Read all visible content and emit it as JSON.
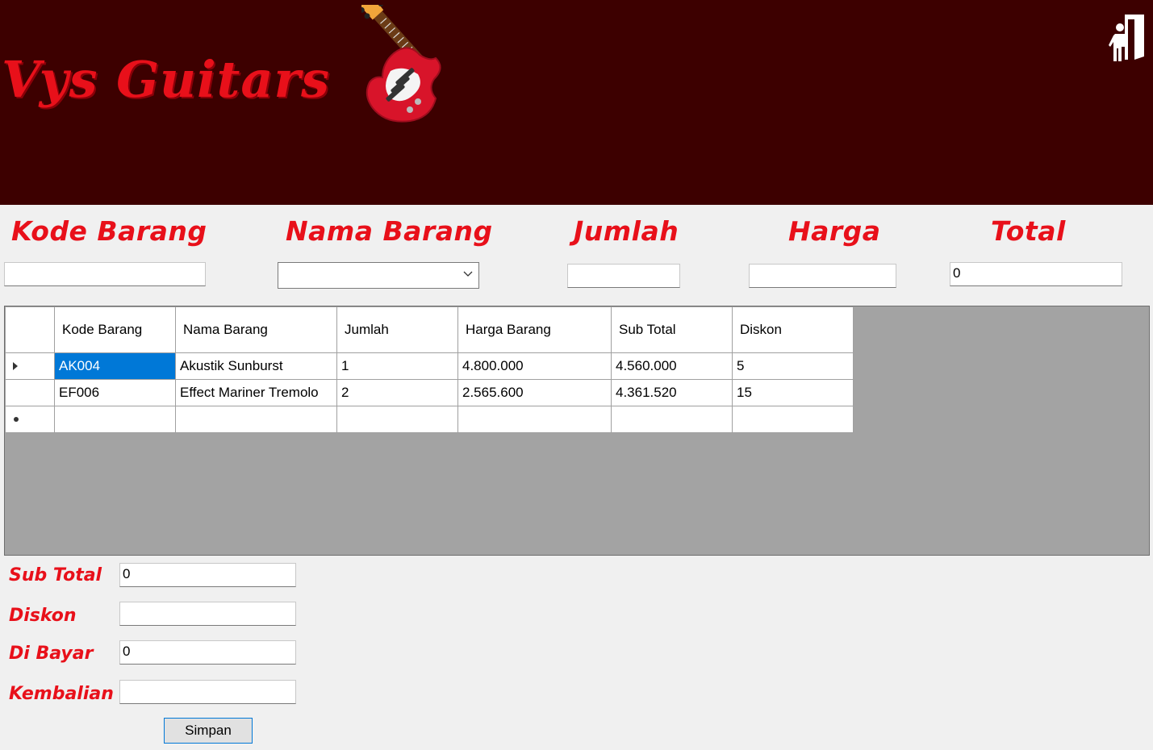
{
  "header": {
    "brand": "Vys Guitars",
    "bg_color": "#3d0000",
    "accent_color": "#e8101a",
    "logo_icon": "guitar-icon",
    "exit_icon": "exit-door-icon"
  },
  "form": {
    "kode_barang": {
      "label": "Kode Barang",
      "value": ""
    },
    "nama_barang": {
      "label": "Nama Barang",
      "value": ""
    },
    "jumlah": {
      "label": "Jumlah",
      "value": ""
    },
    "harga": {
      "label": "Harga",
      "value": ""
    },
    "total": {
      "label": "Total",
      "value": "0"
    }
  },
  "grid": {
    "columns": [
      "Kode Barang",
      "Nama Barang",
      "Jumlah",
      "Harga Barang",
      "Sub Total",
      "Diskon"
    ],
    "rows": [
      [
        "AK004",
        "Akustik Sunburst",
        "1",
        "4.800.000",
        "4.560.000",
        "5"
      ],
      [
        "EF006",
        "Effect Mariner Tremolo",
        "2",
        "2.565.600",
        "4.361.520",
        "15"
      ]
    ],
    "selection_color": "#0078d7"
  },
  "summary": {
    "sub_total": {
      "label": "Sub Total",
      "value": "0"
    },
    "diskon": {
      "label": "Diskon",
      "value": ""
    },
    "di_bayar": {
      "label": "Di Bayar",
      "value": "0"
    },
    "kembalian": {
      "label": "Kembalian",
      "value": ""
    }
  },
  "actions": {
    "save_label": "Simpan"
  }
}
